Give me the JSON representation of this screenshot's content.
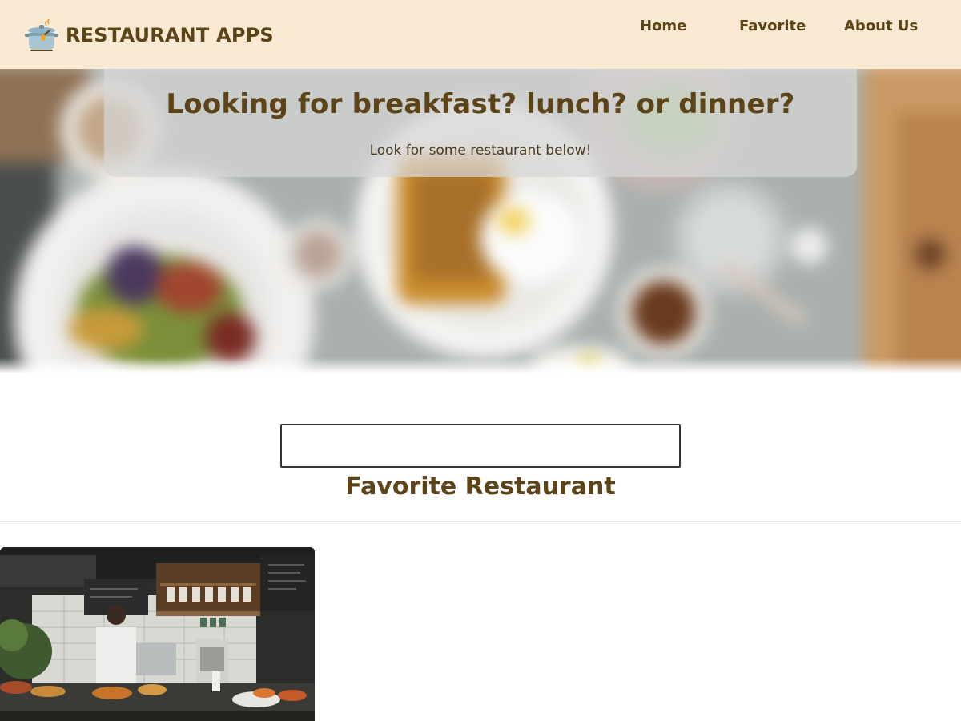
{
  "app": {
    "title": "RESTAURANT APPS",
    "icon": "cooking-pot-icon"
  },
  "nav": {
    "items": [
      {
        "label": "Home"
      },
      {
        "label": "Favorite"
      },
      {
        "label": "About Us"
      }
    ]
  },
  "hero": {
    "title": "Looking for breakfast? lunch? or dinner?",
    "subtitle": "Look for some restaurant below!"
  },
  "search": {
    "value": "",
    "placeholder": ""
  },
  "favorites": {
    "heading": "Favorite Restaurant",
    "items": [
      {
        "image": "restaurant-kitchen-photo"
      }
    ]
  },
  "colors": {
    "header_bg": "#fbead3",
    "brand_text": "#5c4318",
    "hero_card": "#d7d7d7",
    "page_bg": "#ffffff"
  }
}
